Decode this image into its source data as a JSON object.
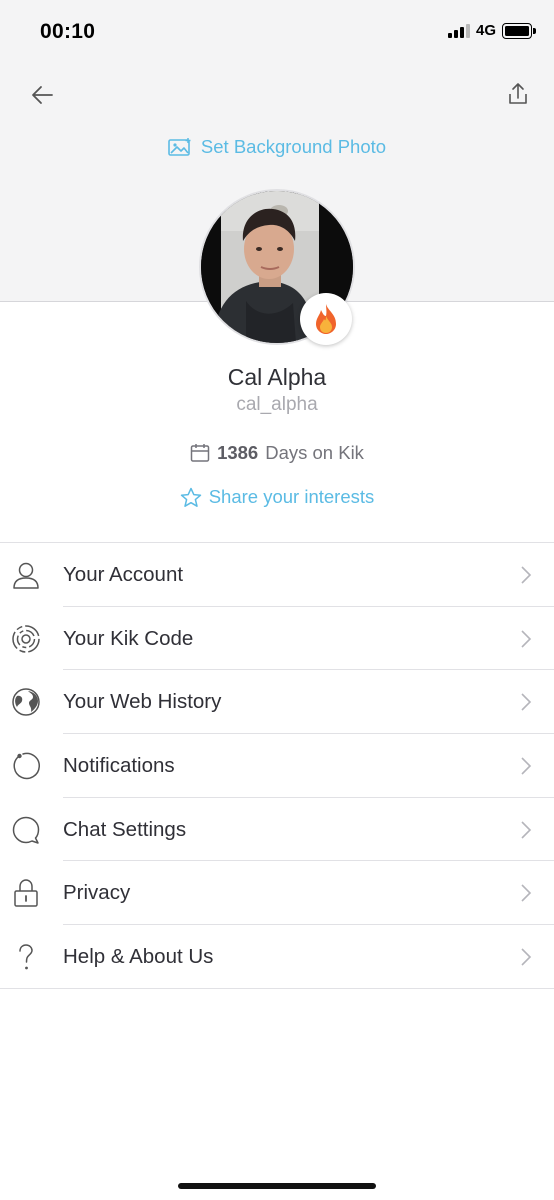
{
  "status_bar": {
    "time": "00:10",
    "network": "4G"
  },
  "header": {
    "set_background_label": "Set Background Photo"
  },
  "profile": {
    "display_name": "Cal Alpha",
    "username": "cal_alpha",
    "days_count": "1386",
    "days_suffix": "Days on Kik",
    "interests_label": "Share your interests"
  },
  "menu": [
    {
      "label": "Your Account",
      "icon": "person-icon"
    },
    {
      "label": "Your Kik Code",
      "icon": "kik-code-icon"
    },
    {
      "label": "Your Web History",
      "icon": "globe-icon"
    },
    {
      "label": "Notifications",
      "icon": "notification-ring-icon"
    },
    {
      "label": "Chat Settings",
      "icon": "chat-bubble-icon"
    },
    {
      "label": "Privacy",
      "icon": "lock-icon"
    },
    {
      "label": "Help & About Us",
      "icon": "question-icon"
    }
  ],
  "colors": {
    "accent": "#5bbbe4",
    "header_bg": "#f4f4f5",
    "text": "#303037",
    "muted": "#a9a9af"
  }
}
